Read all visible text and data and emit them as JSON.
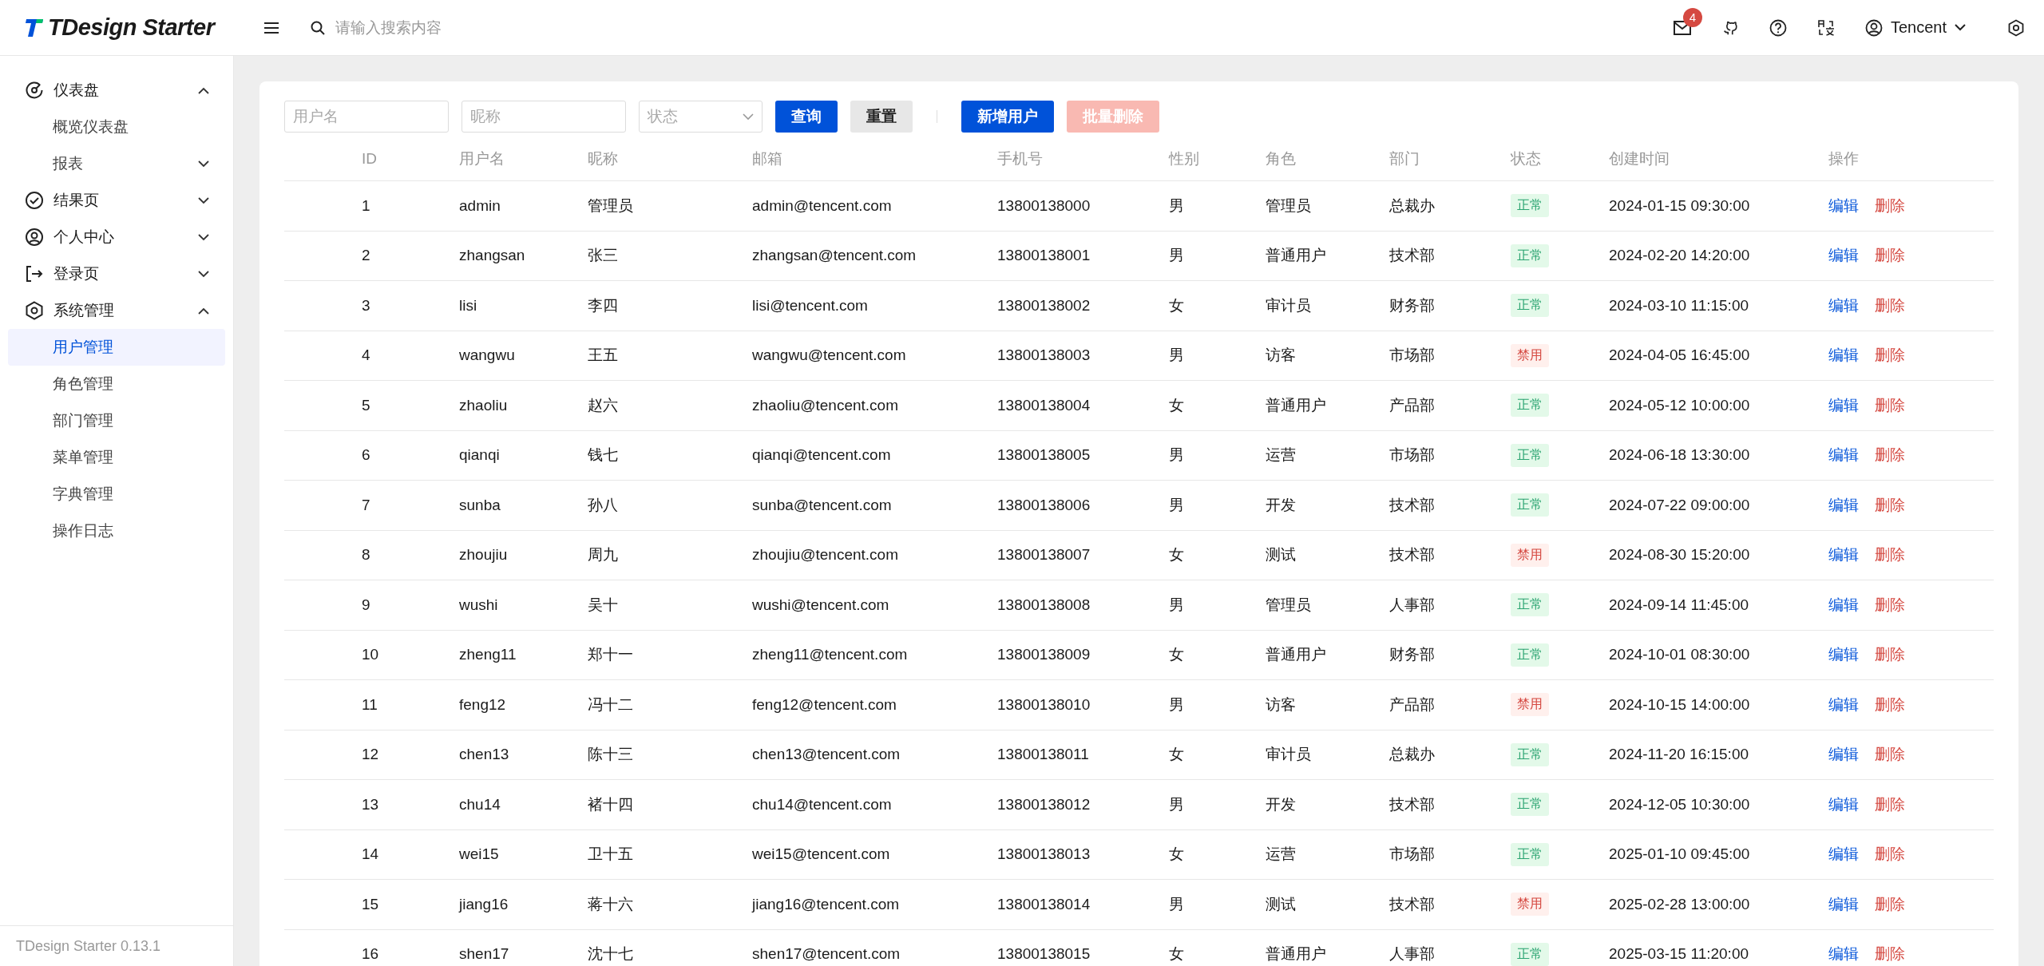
{
  "header": {
    "logo": "TDesign Starter",
    "search": {
      "placeholder": "请输入搜索内容"
    },
    "notifications": {
      "badge": "4"
    },
    "user": {
      "name": "Tencent"
    }
  },
  "sidebar": {
    "items": [
      {
        "label": "仪表盘",
        "expanded": true,
        "children": [
          {
            "label": "概览仪表盘",
            "selected": false
          },
          {
            "label": "报表",
            "expanded": false,
            "selected": false
          }
        ]
      },
      {
        "label": "结果页",
        "expanded": false
      },
      {
        "label": "个人中心",
        "expanded": false
      },
      {
        "label": "登录页",
        "expanded": false
      },
      {
        "label": "系统管理",
        "expanded": true,
        "children": [
          {
            "label": "用户管理",
            "selected": true
          },
          {
            "label": "角色管理",
            "selected": false
          },
          {
            "label": "部门管理",
            "selected": false
          },
          {
            "label": "菜单管理",
            "selected": false
          },
          {
            "label": "字典管理",
            "selected": false
          },
          {
            "label": "操作日志",
            "selected": false
          }
        ]
      }
    ],
    "footer": "TDesign Starter 0.13.1"
  },
  "filters": {
    "fields": [
      {
        "kind": "input",
        "placeholder": "用户名"
      },
      {
        "kind": "input",
        "placeholder": "昵称"
      },
      {
        "kind": "select",
        "placeholder": "状态"
      }
    ],
    "search_buttons": [
      {
        "label": "查询",
        "kind": "primary",
        "disabled": false
      },
      {
        "label": "重置",
        "kind": "default",
        "disabled": false
      }
    ],
    "action_buttons": [
      {
        "label": "新增用户",
        "kind": "primary",
        "disabled": false
      },
      {
        "label": "批量删除",
        "kind": "danger",
        "disabled": true
      }
    ]
  },
  "table": {
    "columns": [
      "ID",
      "用户名",
      "昵称",
      "邮箱",
      "手机号",
      "性别",
      "角色",
      "部门",
      "状态",
      "创建时间",
      "操作"
    ],
    "rows": [
      {
        "id": "1",
        "username": "admin",
        "nickname": "管理员",
        "email": "admin@tencent.com",
        "phone": "13800138000",
        "gender": "男",
        "role": "管理员",
        "department": "总裁办",
        "status": {
          "label": "正常",
          "kind": "success"
        },
        "created": "2024-01-15 09:30:00",
        "actions": [
          "编辑",
          "删除"
        ]
      },
      {
        "id": "2",
        "username": "zhangsan",
        "nickname": "张三",
        "email": "zhangsan@tencent.com",
        "phone": "13800138001",
        "gender": "男",
        "role": "普通用户",
        "department": "技术部",
        "status": {
          "label": "正常",
          "kind": "success"
        },
        "created": "2024-02-20 14:20:00",
        "actions": [
          "编辑",
          "删除"
        ]
      },
      {
        "id": "3",
        "username": "lisi",
        "nickname": "李四",
        "email": "lisi@tencent.com",
        "phone": "13800138002",
        "gender": "女",
        "role": "审计员",
        "department": "财务部",
        "status": {
          "label": "正常",
          "kind": "success"
        },
        "created": "2024-03-10 11:15:00",
        "actions": [
          "编辑",
          "删除"
        ]
      },
      {
        "id": "4",
        "username": "wangwu",
        "nickname": "王五",
        "email": "wangwu@tencent.com",
        "phone": "13800138003",
        "gender": "男",
        "role": "访客",
        "department": "市场部",
        "status": {
          "label": "禁用",
          "kind": "danger"
        },
        "created": "2024-04-05 16:45:00",
        "actions": [
          "编辑",
          "删除"
        ]
      },
      {
        "id": "5",
        "username": "zhaoliu",
        "nickname": "赵六",
        "email": "zhaoliu@tencent.com",
        "phone": "13800138004",
        "gender": "女",
        "role": "普通用户",
        "department": "产品部",
        "status": {
          "label": "正常",
          "kind": "success"
        },
        "created": "2024-05-12 10:00:00",
        "actions": [
          "编辑",
          "删除"
        ]
      },
      {
        "id": "6",
        "username": "qianqi",
        "nickname": "钱七",
        "email": "qianqi@tencent.com",
        "phone": "13800138005",
        "gender": "男",
        "role": "运营",
        "department": "市场部",
        "status": {
          "label": "正常",
          "kind": "success"
        },
        "created": "2024-06-18 13:30:00",
        "actions": [
          "编辑",
          "删除"
        ]
      },
      {
        "id": "7",
        "username": "sunba",
        "nickname": "孙八",
        "email": "sunba@tencent.com",
        "phone": "13800138006",
        "gender": "男",
        "role": "开发",
        "department": "技术部",
        "status": {
          "label": "正常",
          "kind": "success"
        },
        "created": "2024-07-22 09:00:00",
        "actions": [
          "编辑",
          "删除"
        ]
      },
      {
        "id": "8",
        "username": "zhoujiu",
        "nickname": "周九",
        "email": "zhoujiu@tencent.com",
        "phone": "13800138007",
        "gender": "女",
        "role": "测试",
        "department": "技术部",
        "status": {
          "label": "禁用",
          "kind": "danger"
        },
        "created": "2024-08-30 15:20:00",
        "actions": [
          "编辑",
          "删除"
        ]
      },
      {
        "id": "9",
        "username": "wushi",
        "nickname": "吴十",
        "email": "wushi@tencent.com",
        "phone": "13800138008",
        "gender": "男",
        "role": "管理员",
        "department": "人事部",
        "status": {
          "label": "正常",
          "kind": "success"
        },
        "created": "2024-09-14 11:45:00",
        "actions": [
          "编辑",
          "删除"
        ]
      },
      {
        "id": "10",
        "username": "zheng11",
        "nickname": "郑十一",
        "email": "zheng11@tencent.com",
        "phone": "13800138009",
        "gender": "女",
        "role": "普通用户",
        "department": "财务部",
        "status": {
          "label": "正常",
          "kind": "success"
        },
        "created": "2024-10-01 08:30:00",
        "actions": [
          "编辑",
          "删除"
        ]
      },
      {
        "id": "11",
        "username": "feng12",
        "nickname": "冯十二",
        "email": "feng12@tencent.com",
        "phone": "13800138010",
        "gender": "男",
        "role": "访客",
        "department": "产品部",
        "status": {
          "label": "禁用",
          "kind": "danger"
        },
        "created": "2024-10-15 14:00:00",
        "actions": [
          "编辑",
          "删除"
        ]
      },
      {
        "id": "12",
        "username": "chen13",
        "nickname": "陈十三",
        "email": "chen13@tencent.com",
        "phone": "13800138011",
        "gender": "女",
        "role": "审计员",
        "department": "总裁办",
        "status": {
          "label": "正常",
          "kind": "success"
        },
        "created": "2024-11-20 16:15:00",
        "actions": [
          "编辑",
          "删除"
        ]
      },
      {
        "id": "13",
        "username": "chu14",
        "nickname": "褚十四",
        "email": "chu14@tencent.com",
        "phone": "13800138012",
        "gender": "男",
        "role": "开发",
        "department": "技术部",
        "status": {
          "label": "正常",
          "kind": "success"
        },
        "created": "2024-12-05 10:30:00",
        "actions": [
          "编辑",
          "删除"
        ]
      },
      {
        "id": "14",
        "username": "wei15",
        "nickname": "卫十五",
        "email": "wei15@tencent.com",
        "phone": "13800138013",
        "gender": "女",
        "role": "运营",
        "department": "市场部",
        "status": {
          "label": "正常",
          "kind": "success"
        },
        "created": "2025-01-10 09:45:00",
        "actions": [
          "编辑",
          "删除"
        ]
      },
      {
        "id": "15",
        "username": "jiang16",
        "nickname": "蒋十六",
        "email": "jiang16@tencent.com",
        "phone": "13800138014",
        "gender": "男",
        "role": "测试",
        "department": "技术部",
        "status": {
          "label": "禁用",
          "kind": "danger"
        },
        "created": "2025-02-28 13:00:00",
        "actions": [
          "编辑",
          "删除"
        ]
      },
      {
        "id": "16",
        "username": "shen17",
        "nickname": "沈十七",
        "email": "shen17@tencent.com",
        "phone": "13800138015",
        "gender": "女",
        "role": "普通用户",
        "department": "人事部",
        "status": {
          "label": "正常",
          "kind": "success"
        },
        "created": "2025-03-15 11:20:00",
        "actions": [
          "编辑",
          "删除"
        ]
      }
    ]
  }
}
